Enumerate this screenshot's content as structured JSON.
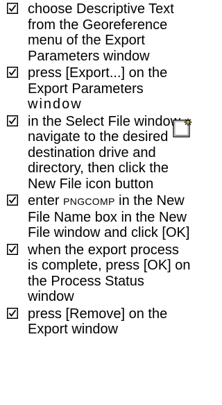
{
  "steps": [
    {
      "text": "choose Descriptive Text from the Georeference menu of the Export Parameters window"
    },
    {
      "text_a": "press [Export...] on the Export Parameters",
      "text_b": "window"
    },
    {
      "text": "in the Select File window, navigate to the desired destination drive and directory, then click the New File icon button",
      "icon": "new-file-icon"
    },
    {
      "pre": "enter ",
      "code": "PNGCOMP",
      "post": " in the New File Name box in the New File window and click [OK]"
    },
    {
      "text": "when the export process is complete, press [OK] on the Process Status window"
    },
    {
      "text": "press [Remove] on the Export window"
    }
  ],
  "checkbox_glyph": "☑",
  "colors": {
    "text": "#000000",
    "background": "#ffffff",
    "icon_star": "#d4bc1c"
  }
}
